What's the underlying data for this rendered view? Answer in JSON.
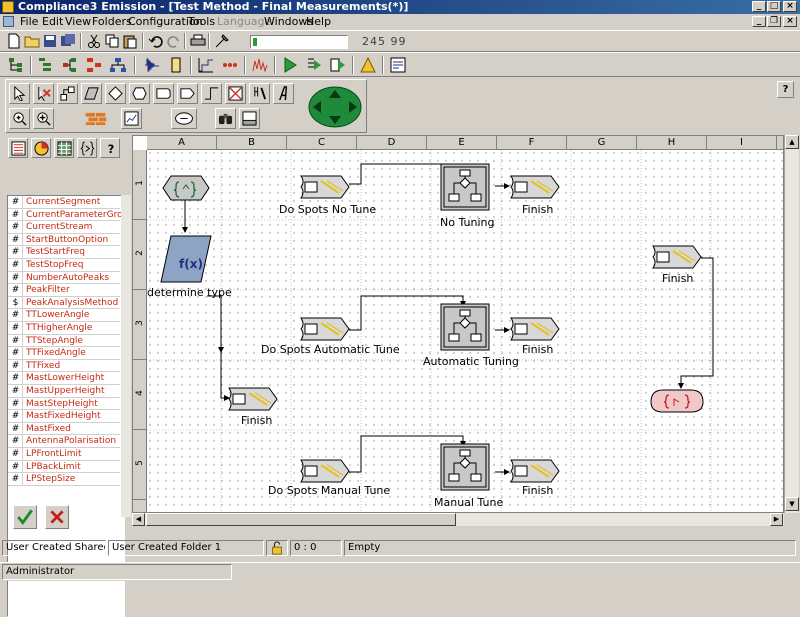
{
  "window": {
    "title": "Compliance3 Emission - [Test Method - Final Measurements(*)]",
    "controls": {
      "minimize": "_",
      "maximize": "□",
      "close": "×"
    },
    "doc_controls": {
      "minimize": "_",
      "restore": "❐",
      "close": "×"
    }
  },
  "menu": {
    "items": [
      "File",
      "Edit",
      "View",
      "Folders",
      "Configuration",
      "Tools",
      "Language",
      "Windows",
      "Help"
    ]
  },
  "toolbar": {
    "progress_percent": 4,
    "progress_value": "245 99"
  },
  "help_button": "?",
  "left_panel": {
    "params": [
      {
        "sym": "#",
        "name": "CurrentSegment"
      },
      {
        "sym": "#",
        "name": "CurrentParameterGroup"
      },
      {
        "sym": "#",
        "name": "CurrentStream"
      },
      {
        "sym": "#",
        "name": "StartButtonOption"
      },
      {
        "sym": "#",
        "name": "TestStartFreq"
      },
      {
        "sym": "#",
        "name": "TestStopFreq"
      },
      {
        "sym": "#",
        "name": "NumberAutoPeaks"
      },
      {
        "sym": "#",
        "name": "PeakFilter"
      },
      {
        "sym": "$",
        "name": "PeakAnalysisMethod"
      },
      {
        "sym": "#",
        "name": "TTLowerAngle"
      },
      {
        "sym": "#",
        "name": "TTHigherAngle"
      },
      {
        "sym": "#",
        "name": "TTStepAngle"
      },
      {
        "sym": "#",
        "name": "TTFixedAngle"
      },
      {
        "sym": "#",
        "name": "TTFixed"
      },
      {
        "sym": "#",
        "name": "MastLowerHeight"
      },
      {
        "sym": "#",
        "name": "MastUpperHeight"
      },
      {
        "sym": "#",
        "name": "MastStepHeight"
      },
      {
        "sym": "#",
        "name": "MastFixedHeight"
      },
      {
        "sym": "#",
        "name": "MastFixed"
      },
      {
        "sym": "#",
        "name": "AntennaPolarisation"
      },
      {
        "sym": "#",
        "name": "LPFrontLimit"
      },
      {
        "sym": "#",
        "name": "LPBackLimit"
      },
      {
        "sym": "#",
        "name": "LPStepSize"
      }
    ]
  },
  "grid": {
    "columns": [
      "A",
      "B",
      "C",
      "D",
      "E",
      "F",
      "G",
      "H",
      "I"
    ],
    "rows": [
      "1",
      "2",
      "3",
      "4",
      "5"
    ]
  },
  "diagram": {
    "labels": {
      "determine_type": "determine type",
      "fx": "f(x)",
      "finish_a4": "Finish",
      "do_spots_no_tune": "Do Spots No Tune",
      "no_tuning": "No Tuning",
      "finish_1": "Finish",
      "do_spots_auto": "Do Spots Automatic Tune",
      "automatic_tuning": "Automatic Tuning",
      "finish_3": "Finish",
      "do_spots_manual": "Do Spots Manual Tune",
      "manual_tune": "Manual Tune",
      "finish_5": "Finish",
      "finish_h2": "Finish"
    }
  },
  "status": {
    "shared": "User Created Shared /",
    "folder": "User Created Folder 1",
    "position": "0 : 0",
    "state": "Empty",
    "user": "Administrator"
  }
}
